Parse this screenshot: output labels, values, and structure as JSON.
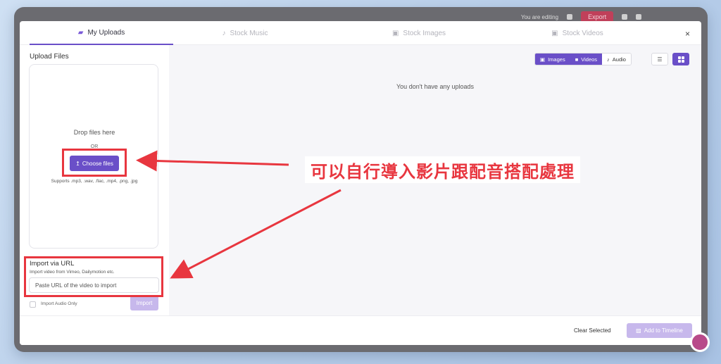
{
  "background_app": {
    "status_text": "You are editing",
    "export_label": "Export"
  },
  "tabs": [
    {
      "label": "My Uploads",
      "icon": "folder-icon",
      "active": true
    },
    {
      "label": "Stock Music",
      "icon": "music-note-icon",
      "active": false
    },
    {
      "label": "Stock Images",
      "icon": "image-icon",
      "active": false
    },
    {
      "label": "Stock Videos",
      "icon": "video-icon",
      "active": false
    }
  ],
  "close_label": "×",
  "upload": {
    "title": "Upload Files",
    "drop_text": "Drop files here",
    "or_text": "OR",
    "choose_label": "Choose files",
    "choose_icon": "↥",
    "supports": "Supports .mp3, .wav, .flac, .mp4, .png, .jpg"
  },
  "import_url": {
    "title": "Import via URL",
    "subtitle": "Import video from Vimeo, Dailymotion etc.",
    "placeholder": "Paste URL of the video to import",
    "audio_only_label": "Import Audio Only",
    "import_label": "Import"
  },
  "filters": [
    {
      "label": "Images",
      "icon": "image-icon",
      "on": true
    },
    {
      "label": "Videos",
      "icon": "video-camera-icon",
      "on": true
    },
    {
      "label": "Audio",
      "icon": "music-note-icon",
      "on": false
    }
  ],
  "empty_message": "You don't have any uploads",
  "footer": {
    "clear_label": "Clear Selected",
    "add_label": "Add to Timeline"
  },
  "annotation": {
    "caption": "可以自行導入影片跟配音搭配處理",
    "color": "#e8363f"
  },
  "colors": {
    "accent": "#6a4fc8",
    "accent_disabled": "#c7b8ec"
  }
}
